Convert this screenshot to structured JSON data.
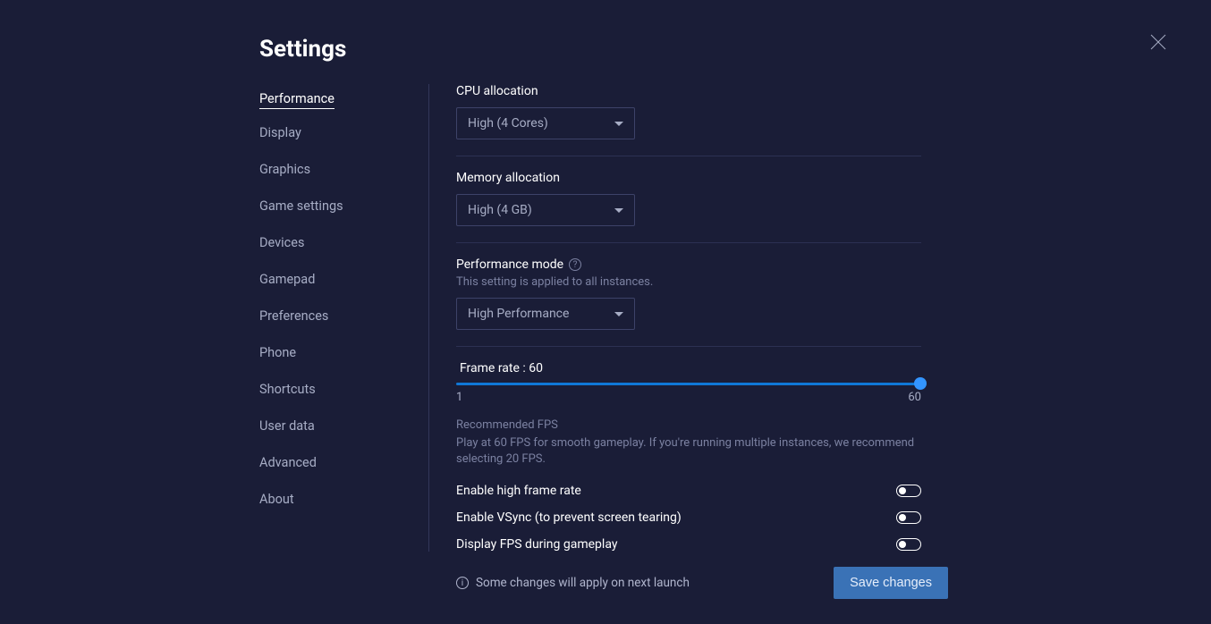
{
  "title": "Settings",
  "sidebar": {
    "items": [
      {
        "label": "Performance",
        "active": true
      },
      {
        "label": "Display"
      },
      {
        "label": "Graphics"
      },
      {
        "label": "Game settings"
      },
      {
        "label": "Devices"
      },
      {
        "label": "Gamepad"
      },
      {
        "label": "Preferences"
      },
      {
        "label": "Phone"
      },
      {
        "label": "Shortcuts"
      },
      {
        "label": "User data"
      },
      {
        "label": "Advanced"
      },
      {
        "label": "About"
      }
    ]
  },
  "cpu": {
    "label": "CPU allocation",
    "value": "High (4 Cores)"
  },
  "memory": {
    "label": "Memory allocation",
    "value": "High (4 GB)"
  },
  "perfmode": {
    "label": "Performance mode",
    "sub": "This setting is applied to all instances.",
    "value": "High Performance"
  },
  "framerate": {
    "label_prefix": "Frame rate : ",
    "value": "60",
    "min": "1",
    "max": "60",
    "recommend_title": "Recommended FPS",
    "recommend_text": "Play at 60 FPS for smooth gameplay. If you're running multiple instances, we recommend selecting 20 FPS."
  },
  "toggles": {
    "high_frame": "Enable high frame rate",
    "vsync": "Enable VSync (to prevent screen tearing)",
    "display_fps": "Display FPS during gameplay"
  },
  "footer": {
    "note": "Some changes will apply on next launch",
    "save": "Save changes"
  }
}
